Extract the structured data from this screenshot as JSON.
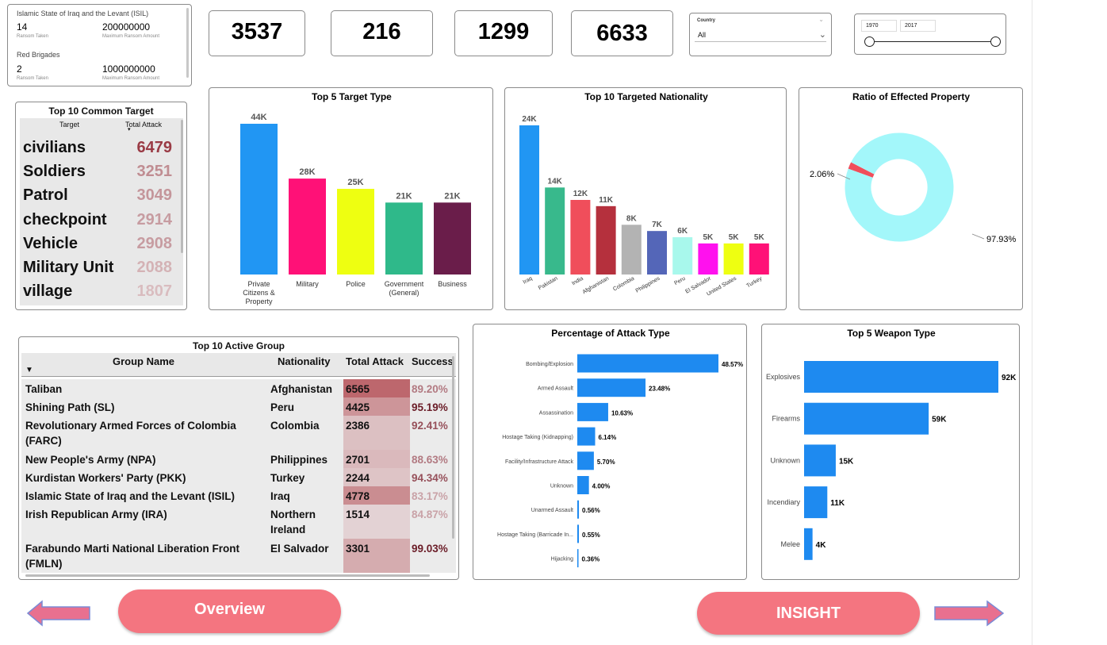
{
  "ransom": [
    {
      "group": "Islamic State of Iraq and the Levant (ISIL)",
      "taken": "14",
      "taken_label": "Ransom Taken",
      "max": "200000000",
      "max_label": "Maximum Ransom Amount"
    },
    {
      "group": "Red Brigades",
      "taken": "2",
      "taken_label": "Ransom Taken",
      "max": "1000000000",
      "max_label": "Maximum Ransom Amount"
    }
  ],
  "kpis": [
    "3537",
    "216",
    "1299",
    "6633"
  ],
  "country_slicer": {
    "label": "Country",
    "value": "All"
  },
  "year_range": {
    "start": "1970",
    "end": "2017"
  },
  "common_target": {
    "title": "Top 10 Common Target",
    "col_target": "Target",
    "col_total": "Total Attack",
    "rows": [
      {
        "name": "civilians",
        "value": "6479"
      },
      {
        "name": "Soldiers",
        "value": "3251"
      },
      {
        "name": "Patrol",
        "value": "3049"
      },
      {
        "name": "checkpoint",
        "value": "2914"
      },
      {
        "name": "Vehicle",
        "value": "2908"
      },
      {
        "name": "Military Unit",
        "value": "2088"
      },
      {
        "name": "village",
        "value": "1807"
      }
    ]
  },
  "active_group": {
    "title": "Top 10 Active Group",
    "headers": [
      "Group Name",
      "Nationality",
      "Total Attack",
      "Success"
    ],
    "rows": [
      {
        "name": "Taliban",
        "nat": "Afghanistan",
        "total": "6565",
        "success": "89.20%"
      },
      {
        "name": "Shining Path (SL)",
        "nat": "Peru",
        "total": "4425",
        "success": "95.19%"
      },
      {
        "name": "Revolutionary Armed Forces of Colombia (FARC)",
        "nat": "Colombia",
        "total": "2386",
        "success": "92.41%"
      },
      {
        "name": "New People's Army (NPA)",
        "nat": "Philippines",
        "total": "2701",
        "success": "88.63%"
      },
      {
        "name": "Kurdistan Workers' Party (PKK)",
        "nat": "Turkey",
        "total": "2244",
        "success": "94.34%"
      },
      {
        "name": "Islamic State of Iraq and the Levant (ISIL)",
        "nat": "Iraq",
        "total": "4778",
        "success": "83.17%"
      },
      {
        "name": "Irish Republican Army (IRA)",
        "nat": "Northern Ireland",
        "total": "1514",
        "success": "84.87%"
      },
      {
        "name": "Farabundo Marti National Liberation Front (FMLN)",
        "nat": "El Salvador",
        "total": "3301",
        "success": "99.03%"
      }
    ]
  },
  "buttons": {
    "overview": "Overview",
    "insight": "INSIGHT"
  },
  "chart_data": [
    {
      "type": "bar",
      "title": "Top 5 Target Type",
      "categories": [
        "Private Citizens & Property",
        "Military",
        "Police",
        "Government (General)",
        "Business"
      ],
      "values": [
        44000,
        28000,
        25000,
        21000,
        21000
      ],
      "labels": [
        "44K",
        "28K",
        "25K",
        "21K",
        "21K"
      ],
      "colors": [
        "#2196f3",
        "#ff1177",
        "#eeff11",
        "#2fb98a",
        "#6a1d4a"
      ]
    },
    {
      "type": "bar",
      "title": "Top 10 Targeted Nationality",
      "categories": [
        "Iraq",
        "Pakistan",
        "India",
        "Afghanistan",
        "Colombia",
        "Philippines",
        "Peru",
        "El Salvador",
        "United States",
        "Turkey"
      ],
      "values": [
        24000,
        14000,
        12000,
        11000,
        8000,
        7000,
        6000,
        5000,
        5000,
        5000
      ],
      "labels": [
        "24K",
        "14K",
        "12K",
        "11K",
        "8K",
        "7K",
        "6K",
        "5K",
        "5K",
        "5K"
      ],
      "colors": [
        "#2196f3",
        "#38b98c",
        "#f04e5b",
        "#b5303d",
        "#b3b3b3",
        "#5466b8",
        "#a8f8ec",
        "#ff11ee",
        "#eeff11",
        "#ff1177"
      ]
    },
    {
      "type": "pie",
      "title": "Ratio of Effected Property",
      "values": [
        2.06,
        97.93
      ],
      "labels": [
        "2.06%",
        "97.93%"
      ],
      "colors": [
        "#f04e5b",
        "#a3f7fa"
      ]
    },
    {
      "type": "bar",
      "title": "Percentage of Attack Type",
      "categories": [
        "Bombing/Explosion",
        "Armed Assault",
        "Assassination",
        "Hostage Taking (Kidnapping)",
        "Facility/Infrastructure Attack",
        "Unknown",
        "Unarmed Assault",
        "Hostage Taking (Barricade In...",
        "Hijacking"
      ],
      "values": [
        48.57,
        23.48,
        10.63,
        6.14,
        5.7,
        4.0,
        0.56,
        0.55,
        0.36
      ],
      "labels": [
        "48.57%",
        "23.48%",
        "10.63%",
        "6.14%",
        "5.70%",
        "4.00%",
        "0.56%",
        "0.55%",
        "0.36%"
      ],
      "color": "#1e8af0"
    },
    {
      "type": "bar",
      "title": "Top 5 Weapon Type",
      "categories": [
        "Explosives",
        "Firearms",
        "Unknown",
        "Incendiary",
        "Melee"
      ],
      "values": [
        92000,
        59000,
        15000,
        11000,
        4000
      ],
      "labels": [
        "92K",
        "59K",
        "15K",
        "11K",
        "4K"
      ],
      "color": "#1e8af0"
    }
  ]
}
